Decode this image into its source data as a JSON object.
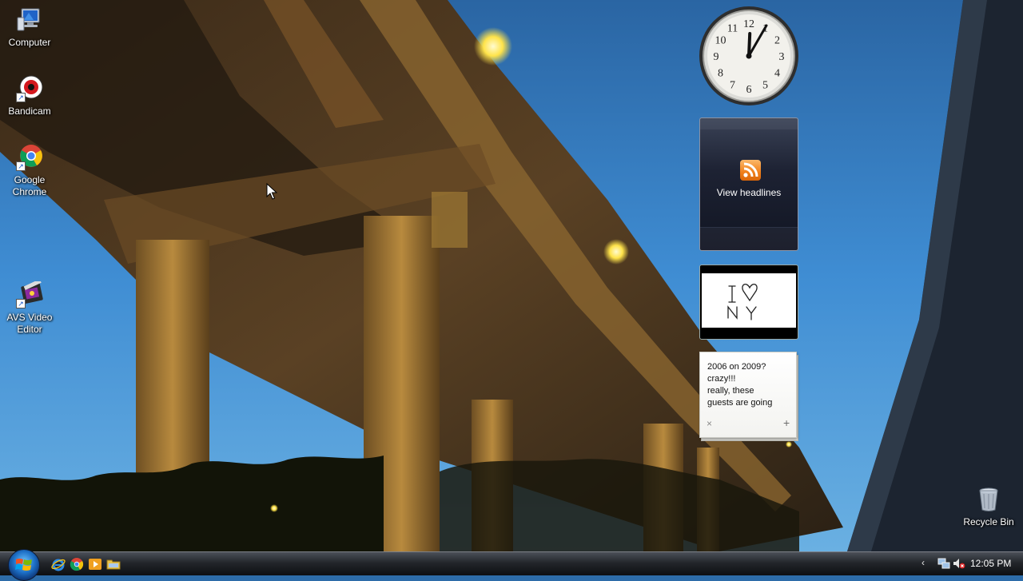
{
  "desktop": {
    "icons": [
      {
        "label_line1": "Computer",
        "label_line2": "",
        "icon": "computer-icon"
      },
      {
        "label_line1": "Bandicam",
        "label_line2": "",
        "icon": "bandicam-icon"
      },
      {
        "label_line1": "Google",
        "label_line2": "Chrome",
        "icon": "chrome-icon"
      },
      {
        "label_line1": "AVS Video",
        "label_line2": "Editor",
        "icon": "avs-video-editor-icon"
      },
      {
        "label_line1": "Recycle Bin",
        "label_line2": "",
        "icon": "recycle-bin-icon"
      }
    ]
  },
  "gadgets": {
    "clock": {
      "numerals": [
        "12",
        "1",
        "2",
        "3",
        "4",
        "5",
        "6",
        "7",
        "8",
        "9",
        "10",
        "11"
      ],
      "hour": 12,
      "minute": 5
    },
    "feed": {
      "label": "View headlines",
      "icon": "rss-feed-icon",
      "accent": "#f07f1a"
    },
    "notes": {
      "lines": [
        "2006 on 2009?",
        "crazy!!!",
        "really, these",
        "guests are going"
      ],
      "close_symbol": "×",
      "add_symbol": "+"
    }
  },
  "taskbar": {
    "quick_launch": [
      "internet-explorer-icon",
      "chrome-icon",
      "media-player-icon",
      "folder-icon"
    ],
    "tray": {
      "chevron": "‹",
      "network_icon": "network-icon",
      "volume_icon": "volume-muted-icon"
    },
    "time": "12:05 PM"
  },
  "colors": {
    "sky": "#3c8ad0",
    "taskbar": "#1a1c20",
    "start_orb": "#1d6fc6"
  }
}
